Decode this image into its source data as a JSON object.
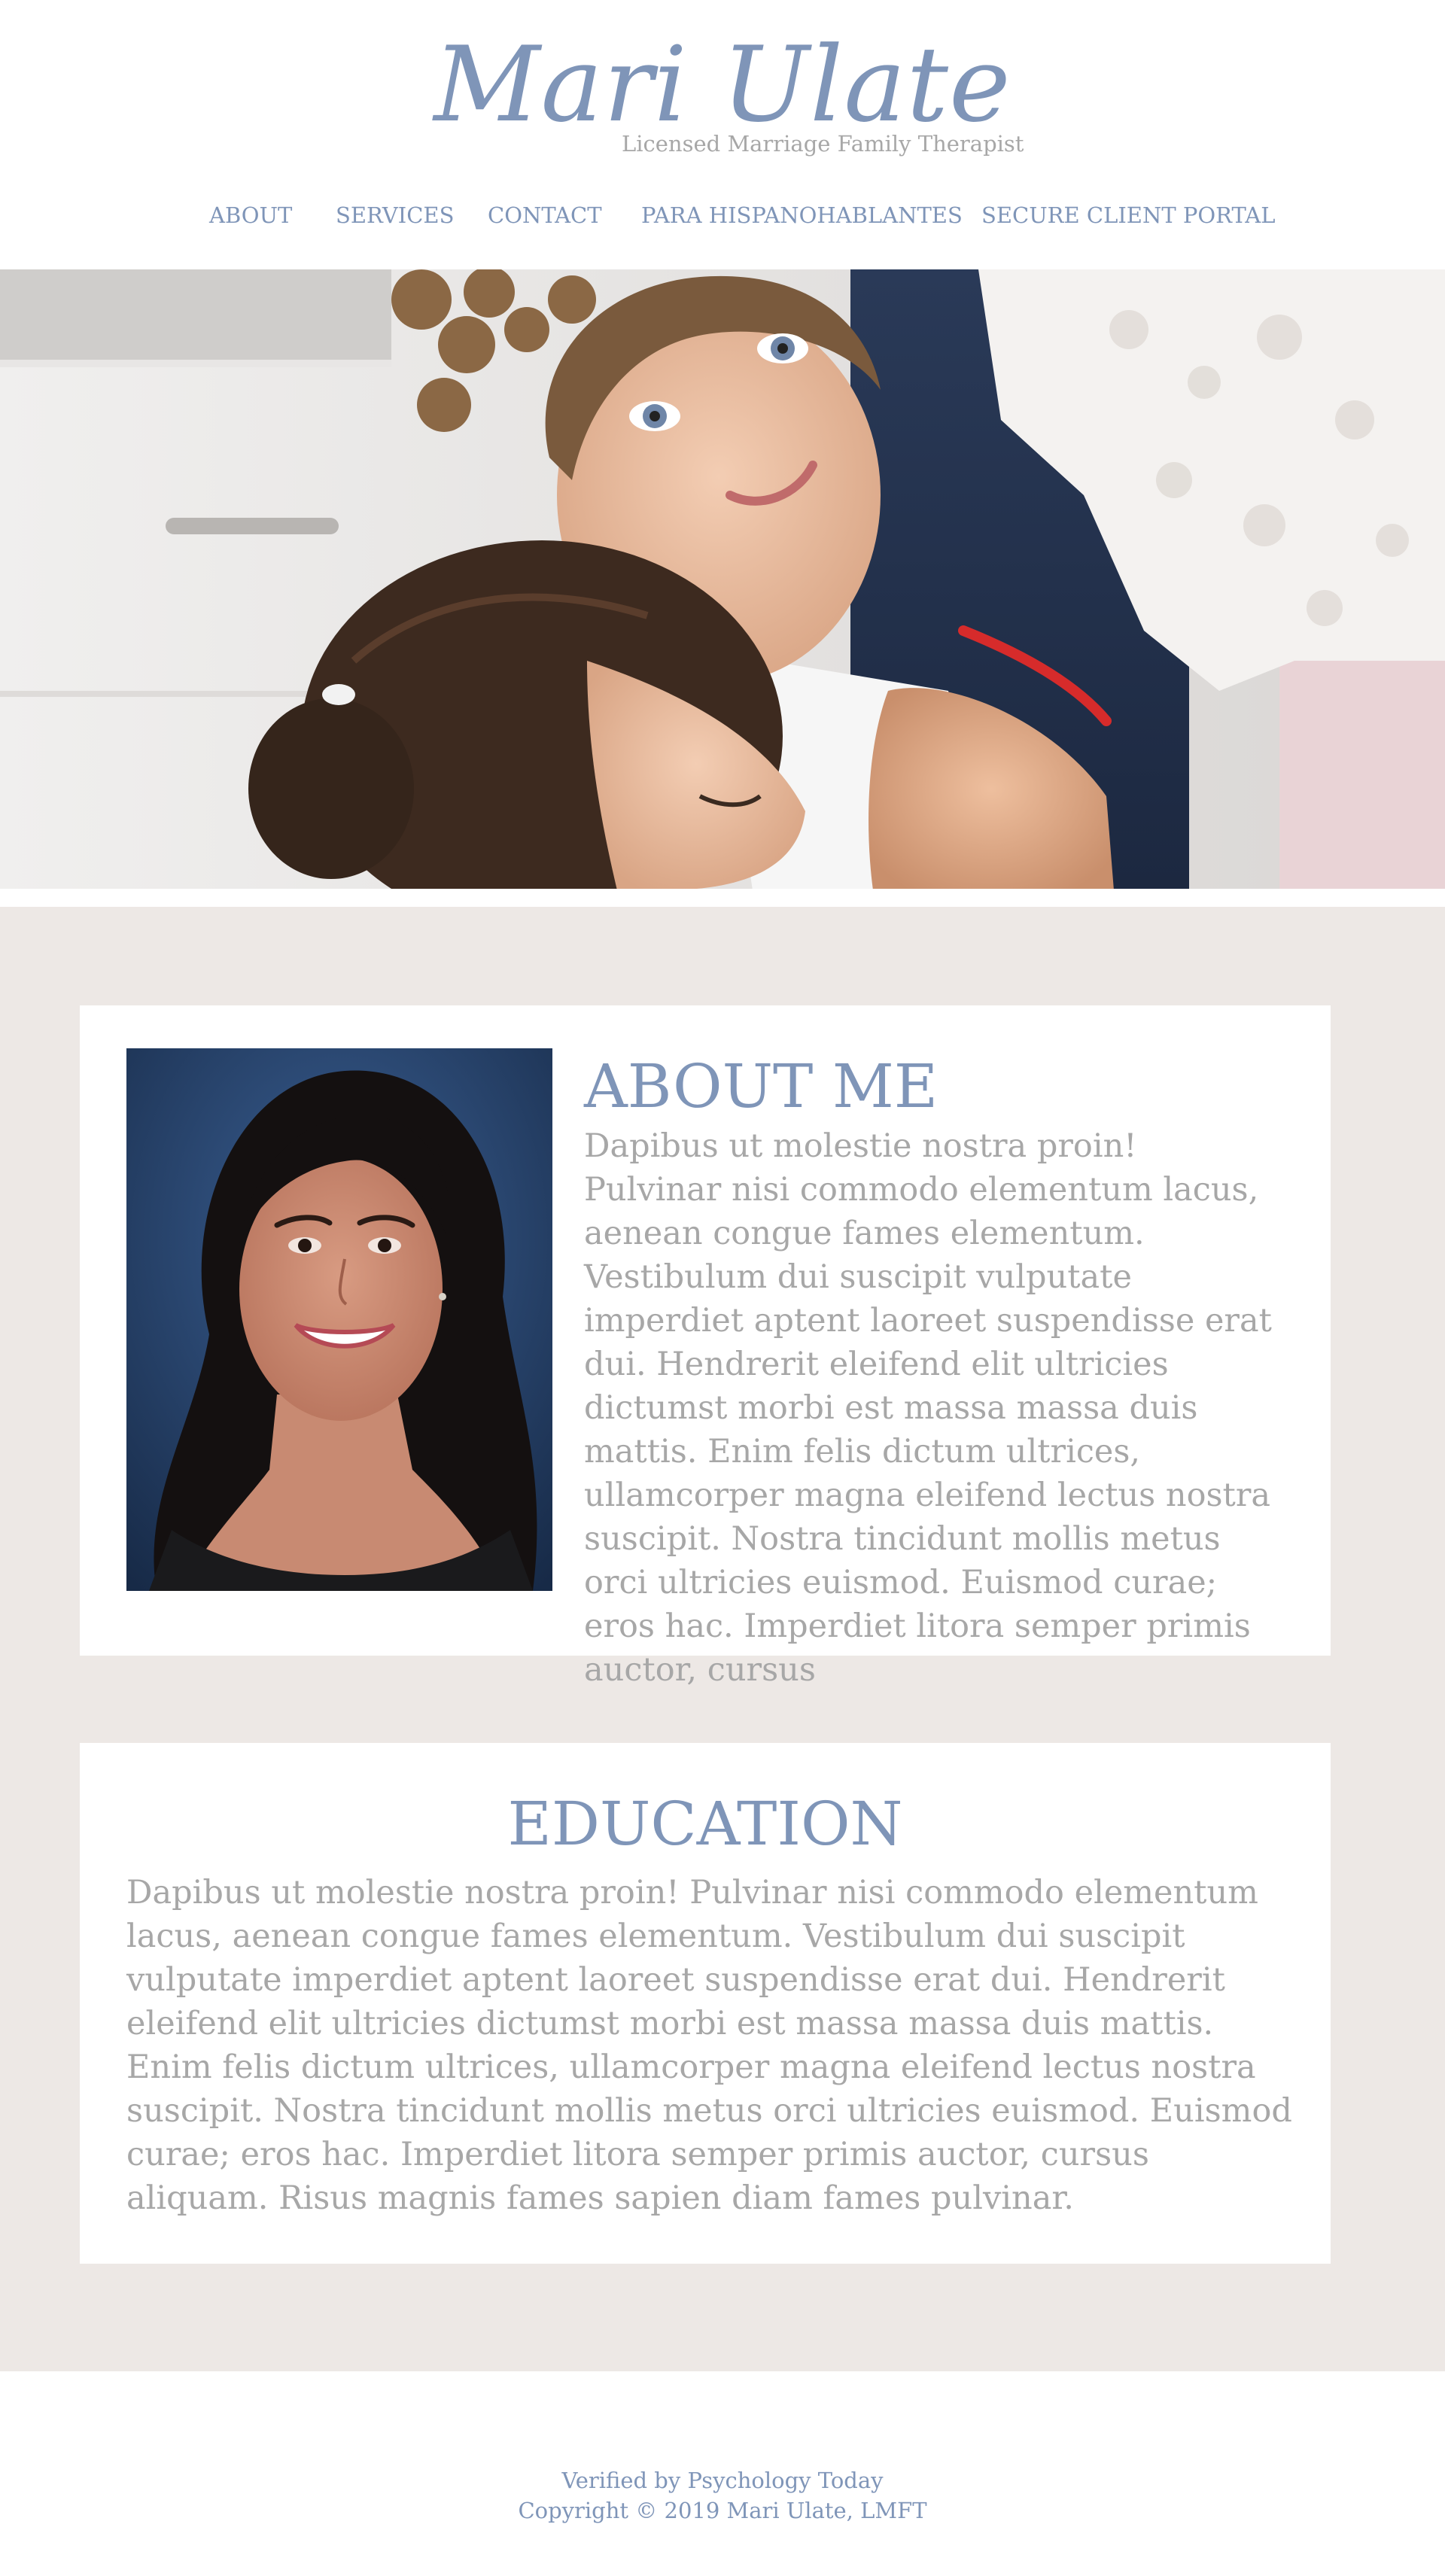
{
  "header": {
    "logo_name": "Mari Ulate",
    "logo_subtitle": "Licensed Marriage Family Therapist"
  },
  "nav": {
    "items": [
      {
        "label": "ABOUT"
      },
      {
        "label": "SERVICES"
      },
      {
        "label": "CONTACT"
      },
      {
        "label": "PARA HISPANOHABLANTES"
      },
      {
        "label": "SECURE CLIENT PORTAL"
      }
    ]
  },
  "about": {
    "title": "ABOUT ME",
    "text": "Dapibus ut molestie nostra proin! Pulvinar nisi commodo elementum lacus, aenean congue fames elementum. Vestibulum dui suscipit vulputate imperdiet aptent laoreet suspendisse erat dui. Hendrerit eleifend elit ultricies dictumst morbi est massa massa duis mattis. Enim felis dictum ultrices, ullamcorper magna eleifend lectus nostra suscipit. Nostra tincidunt mollis metus orci ultricies euismod. Euismod curae; eros hac. Imperdiet litora semper primis auctor, cursus"
  },
  "education": {
    "title": "EDUCATION",
    "text": "Dapibus ut molestie nostra proin! Pulvinar nisi commodo elementum lacus, aenean congue fames elementum. Vestibulum dui suscipit vulputate imperdiet aptent laoreet suspendisse erat dui. Hendrerit eleifend elit ultricies dictumst morbi est massa massa duis mattis. Enim felis dictum ultrices, ullamcorper magna eleifend lectus nostra suscipit. Nostra tincidunt mollis metus orci ultricies euismod. Euismod curae; eros hac. Imperdiet litora semper primis auctor, cursus aliquam. Risus magnis fames sapien diam fames pulvinar."
  },
  "footer": {
    "verified_link": "Verified by Psychology Today",
    "copyright": "Copyright © 2019 Mari Ulate, LMFT"
  },
  "colors": {
    "accent": "#7f95b8",
    "body_text": "#a7a7a7",
    "content_background": "#ede8e5",
    "card_background": "#ffffff"
  }
}
